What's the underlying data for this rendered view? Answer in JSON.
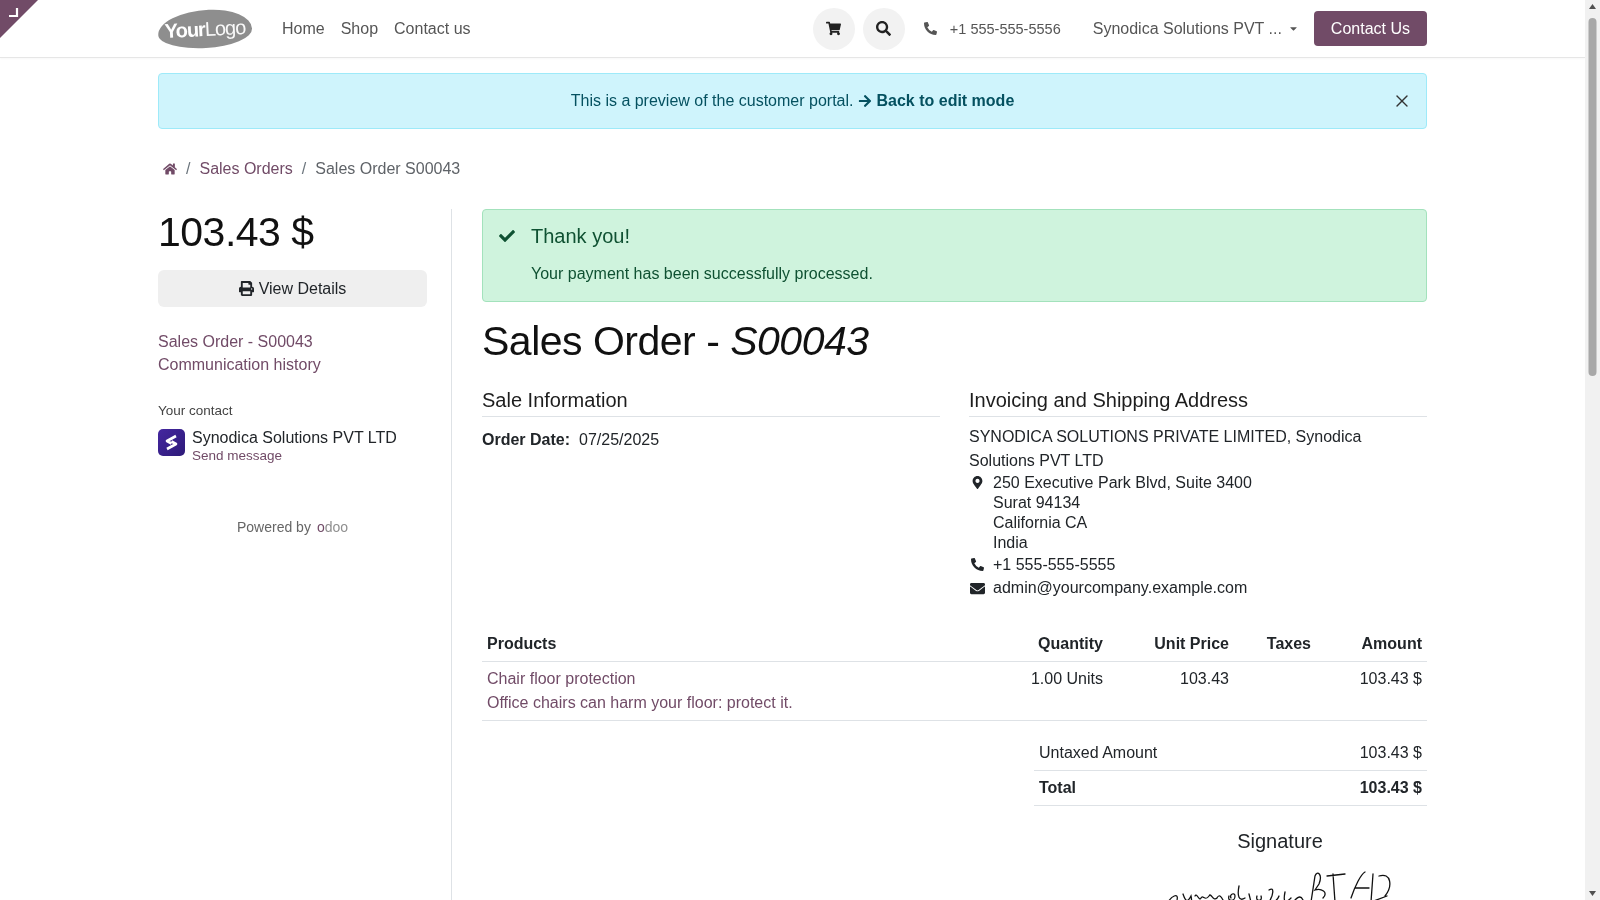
{
  "navbar": {
    "logo": {
      "bold_part": "Your",
      "light_part": "Logo"
    },
    "menu": [
      {
        "label": "Home"
      },
      {
        "label": "Shop"
      },
      {
        "label": "Contact us"
      }
    ],
    "phone": "+1 555-555-5556",
    "company_menu": "Synodica Solutions PVT ...",
    "cta_button": "Contact Us"
  },
  "preview_banner": {
    "text": "This is a preview of the customer portal.",
    "link": "Back to edit mode"
  },
  "breadcrumb": [
    {
      "kind": "home"
    },
    {
      "kind": "separator",
      "text": "/"
    },
    {
      "kind": "link",
      "text": "Sales Orders"
    },
    {
      "kind": "separator",
      "text": "/"
    },
    {
      "kind": "current",
      "text": "Sales Order S00043"
    }
  ],
  "sidebar": {
    "amount": "103.43 $",
    "view_details_button": "View Details",
    "links": [
      "Sales Order - S00043",
      "Communication history"
    ],
    "contact": {
      "heading": "Your contact",
      "name": "Synodica Solutions PVT LTD",
      "action": "Send message"
    },
    "powered_by": {
      "text": "Powered by",
      "brand": "odoo"
    }
  },
  "alert": {
    "title": "Thank you!",
    "message": "Your payment has been successfully processed."
  },
  "title": "Sales Order - *S00043*",
  "sale_information": {
    "heading": "Sale Information",
    "fields": [
      {
        "label": "Order Date:",
        "value": "07/25/2025"
      }
    ]
  },
  "address": {
    "heading": "Invoicing and Shipping Address",
    "name": "SYNODICA SOLUTIONS PRIVATE LIMITED, Synodica Solutions PVT LTD",
    "lines": [
      "250 Executive Park Blvd, Suite 3400",
      "Surat 94134",
      "California CA",
      "India"
    ],
    "phone": "+1 555-555-5555",
    "email": "admin@yourcompany.example.com"
  },
  "table": {
    "columns": [
      "Products",
      "Quantity",
      "Unit Price",
      "Taxes",
      "Amount"
    ],
    "rows": [
      {
        "product": "Chair floor protection",
        "description": "Office chairs can harm your floor: protect it.",
        "quantity": "1.00 Units",
        "unit_price": "103.43",
        "amount": "103.43 $"
      }
    ]
  },
  "totals": [
    {
      "kind": "subtotal",
      "label": "Untaxed Amount",
      "value": "103.43 $"
    },
    {
      "kind": "total",
      "label": "Total",
      "value": "103.43 $"
    }
  ],
  "signature": {
    "heading": "Signature"
  }
}
